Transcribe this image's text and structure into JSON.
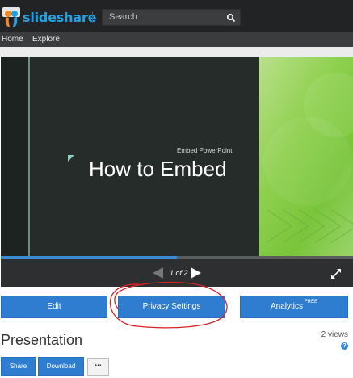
{
  "header": {
    "logo_text": "slideshare",
    "search_placeholder": "Search"
  },
  "nav": {
    "items": [
      "Home",
      "Explore"
    ]
  },
  "slide": {
    "subtitle": "Embed PowerPoint",
    "title": "How to Embed"
  },
  "player": {
    "page_indicator": "1 of 2",
    "progress_fraction": 0.5
  },
  "actions": {
    "edit": "Edit",
    "privacy": "Privacy Settings",
    "analytics": "Analytics",
    "analytics_badge": "FREE"
  },
  "presentation": {
    "title": "Presentation",
    "views": "2 views",
    "help": "?",
    "share": "Share",
    "download": "Download",
    "more": "..."
  },
  "colors": {
    "brand": "#1ea2e5",
    "button": "#2f7dd1",
    "annotation": "#d8232a"
  }
}
